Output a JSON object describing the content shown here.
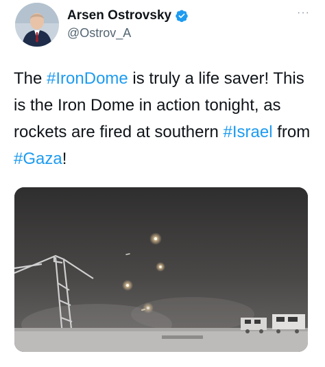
{
  "author": {
    "display_name": "Arsen Ostrovsky",
    "handle": "@Ostrov_A",
    "verified": true,
    "avatar_icon": "profile-photo"
  },
  "more_label": "···",
  "tweet": {
    "t1": "The ",
    "tag1": "#IronDome",
    "t2": " is truly a life saver! This is the Iron Dome in action tonight, as rockets are fired at southern ",
    "tag2": "#Israel",
    "t3": " from ",
    "tag3": "#Gaza",
    "t4": "!"
  },
  "colors": {
    "link": "#1d9bf0",
    "verified": "#1d9bf0",
    "text": "#0f1419",
    "secondary": "#536471"
  },
  "media": {
    "kind": "video-still",
    "subject": "night sky with interceptor flares"
  }
}
